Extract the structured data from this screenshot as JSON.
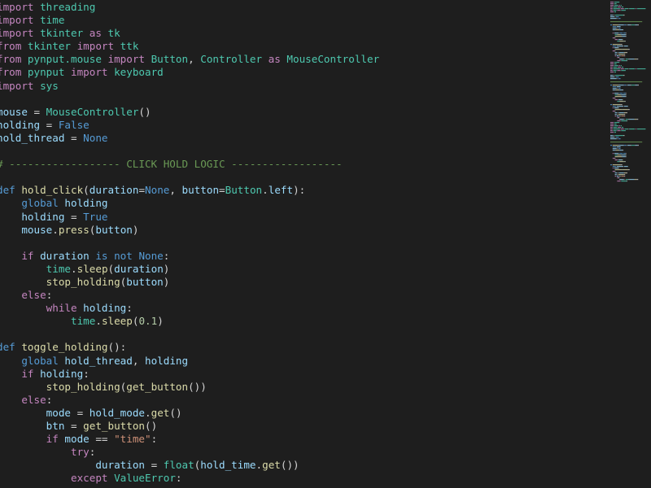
{
  "editor": {
    "lines": [
      [
        [
          "import",
          "kw"
        ],
        [
          " threading",
          "cls"
        ]
      ],
      [
        [
          "import",
          "kw"
        ],
        [
          " time",
          "cls"
        ]
      ],
      [
        [
          "import",
          "kw"
        ],
        [
          " tkinter ",
          "cls"
        ],
        [
          "as",
          "kw"
        ],
        [
          " tk",
          "cls"
        ]
      ],
      [
        [
          "from",
          "kw"
        ],
        [
          " tkinter ",
          "cls"
        ],
        [
          "import",
          "kw"
        ],
        [
          " ttk",
          "cls"
        ]
      ],
      [
        [
          "from",
          "kw"
        ],
        [
          " pynput.mouse ",
          "cls"
        ],
        [
          "import",
          "kw"
        ],
        [
          " Button",
          "cls"
        ],
        [
          ", ",
          "op"
        ],
        [
          "Controller",
          "cls"
        ],
        [
          " as ",
          "kw"
        ],
        [
          "MouseController",
          "cls"
        ]
      ],
      [
        [
          "from",
          "kw"
        ],
        [
          " pynput ",
          "cls"
        ],
        [
          "import",
          "kw"
        ],
        [
          " keyboard",
          "cls"
        ]
      ],
      [
        [
          "import",
          "kw"
        ],
        [
          " sys",
          "cls"
        ]
      ],
      [],
      [
        [
          "mouse",
          "var"
        ],
        [
          " = ",
          "op"
        ],
        [
          "MouseController",
          "cls"
        ],
        [
          "()",
          "op"
        ]
      ],
      [
        [
          "holding",
          "var"
        ],
        [
          " = ",
          "op"
        ],
        [
          "False",
          "kw2"
        ]
      ],
      [
        [
          "hold_thread",
          "var"
        ],
        [
          " = ",
          "op"
        ],
        [
          "None",
          "kw2"
        ]
      ],
      [],
      [
        [
          "# ------------------ CLICK HOLD LOGIC ------------------",
          "cmt"
        ]
      ],
      [],
      [
        [
          "def",
          "kw2"
        ],
        [
          " ",
          "op"
        ],
        [
          "hold_click",
          "fn"
        ],
        [
          "(",
          "op"
        ],
        [
          "duration",
          "var"
        ],
        [
          "=",
          "op"
        ],
        [
          "None",
          "kw2"
        ],
        [
          ", ",
          "op"
        ],
        [
          "button",
          "var"
        ],
        [
          "=",
          "op"
        ],
        [
          "Button",
          "cls"
        ],
        [
          ".",
          "op"
        ],
        [
          "left",
          "var"
        ],
        [
          "):",
          "op"
        ]
      ],
      [
        [
          "    ",
          "op"
        ],
        [
          "global",
          "kw2"
        ],
        [
          " holding",
          "var"
        ]
      ],
      [
        [
          "    ",
          "op"
        ],
        [
          "holding",
          "var"
        ],
        [
          " = ",
          "op"
        ],
        [
          "True",
          "kw2"
        ]
      ],
      [
        [
          "    ",
          "op"
        ],
        [
          "mouse",
          "var"
        ],
        [
          ".",
          "op"
        ],
        [
          "press",
          "fn"
        ],
        [
          "(",
          "op"
        ],
        [
          "button",
          "var"
        ],
        [
          ")",
          "op"
        ]
      ],
      [],
      [
        [
          "    ",
          "op"
        ],
        [
          "if",
          "kw"
        ],
        [
          " duration ",
          "var"
        ],
        [
          "is not",
          "kw2"
        ],
        [
          " ",
          "op"
        ],
        [
          "None",
          "kw2"
        ],
        [
          ":",
          "op"
        ]
      ],
      [
        [
          "        ",
          "op"
        ],
        [
          "time",
          "cls"
        ],
        [
          ".",
          "op"
        ],
        [
          "sleep",
          "fn"
        ],
        [
          "(",
          "op"
        ],
        [
          "duration",
          "var"
        ],
        [
          ")",
          "op"
        ]
      ],
      [
        [
          "        ",
          "op"
        ],
        [
          "stop_holding",
          "fn"
        ],
        [
          "(",
          "op"
        ],
        [
          "button",
          "var"
        ],
        [
          ")",
          "op"
        ]
      ],
      [
        [
          "    ",
          "op"
        ],
        [
          "else",
          "kw"
        ],
        [
          ":",
          "op"
        ]
      ],
      [
        [
          "        ",
          "op"
        ],
        [
          "while",
          "kw"
        ],
        [
          " holding",
          "var"
        ],
        [
          ":",
          "op"
        ]
      ],
      [
        [
          "            ",
          "op"
        ],
        [
          "time",
          "cls"
        ],
        [
          ".",
          "op"
        ],
        [
          "sleep",
          "fn"
        ],
        [
          "(",
          "op"
        ],
        [
          "0.1",
          "num"
        ],
        [
          ")",
          "op"
        ]
      ],
      [],
      [
        [
          "def",
          "kw2"
        ],
        [
          " ",
          "op"
        ],
        [
          "toggle_holding",
          "fn"
        ],
        [
          "():",
          "op"
        ]
      ],
      [
        [
          "    ",
          "op"
        ],
        [
          "global",
          "kw2"
        ],
        [
          " hold_thread",
          "var"
        ],
        [
          ", ",
          "op"
        ],
        [
          "holding",
          "var"
        ]
      ],
      [
        [
          "    ",
          "op"
        ],
        [
          "if",
          "kw"
        ],
        [
          " holding",
          "var"
        ],
        [
          ":",
          "op"
        ]
      ],
      [
        [
          "        ",
          "op"
        ],
        [
          "stop_holding",
          "fn"
        ],
        [
          "(",
          "op"
        ],
        [
          "get_button",
          "fn"
        ],
        [
          "())",
          "op"
        ]
      ],
      [
        [
          "    ",
          "op"
        ],
        [
          "else",
          "kw"
        ],
        [
          ":",
          "op"
        ]
      ],
      [
        [
          "        ",
          "op"
        ],
        [
          "mode",
          "var"
        ],
        [
          " = ",
          "op"
        ],
        [
          "hold_mode",
          "var"
        ],
        [
          ".",
          "op"
        ],
        [
          "get",
          "fn"
        ],
        [
          "()",
          "op"
        ]
      ],
      [
        [
          "        ",
          "op"
        ],
        [
          "btn",
          "var"
        ],
        [
          " = ",
          "op"
        ],
        [
          "get_button",
          "fn"
        ],
        [
          "()",
          "op"
        ]
      ],
      [
        [
          "        ",
          "op"
        ],
        [
          "if",
          "kw"
        ],
        [
          " mode ",
          "var"
        ],
        [
          "==",
          "op"
        ],
        [
          " \"time\"",
          "str"
        ],
        [
          ":",
          "op"
        ]
      ],
      [
        [
          "            ",
          "op"
        ],
        [
          "try",
          "kw"
        ],
        [
          ":",
          "op"
        ]
      ],
      [
        [
          "                ",
          "op"
        ],
        [
          "duration",
          "var"
        ],
        [
          " = ",
          "op"
        ],
        [
          "float",
          "cls"
        ],
        [
          "(",
          "op"
        ],
        [
          "hold_time",
          "var"
        ],
        [
          ".",
          "op"
        ],
        [
          "get",
          "fn"
        ],
        [
          "())",
          "op"
        ]
      ],
      [
        [
          "            ",
          "op"
        ],
        [
          "except",
          "kw"
        ],
        [
          " ",
          "op"
        ],
        [
          "ValueError",
          "cls"
        ],
        [
          ":",
          "op"
        ]
      ]
    ]
  },
  "colors": {
    "background": "#1e1e1e",
    "keyword": "#c586c0",
    "keyword_blue": "#569cd6",
    "variable": "#9cdcfe",
    "function": "#dcdcaa",
    "class": "#4ec9b0",
    "number": "#b5cea8",
    "string": "#ce9178",
    "comment": "#6a9955",
    "text": "#d4d4d4"
  }
}
